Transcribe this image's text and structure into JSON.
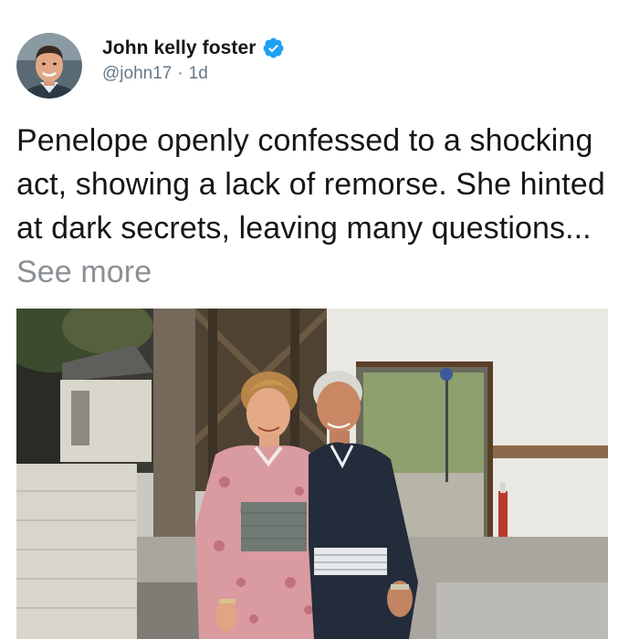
{
  "user": {
    "display_name": "John kelly foster",
    "handle": "@john17",
    "separator": "·",
    "time": "1d",
    "verified_icon": "verified-badge-icon",
    "verified_color": "#1da1f2"
  },
  "post": {
    "text": "Penelope openly confessed to a shocking act, showing a lack of remorse. She hinted at dark secrets, leaving many questions...",
    "see_more_label": "See more"
  },
  "colors": {
    "text": "#14171a",
    "muted": "#657786",
    "see_more": "#8a8f94"
  }
}
